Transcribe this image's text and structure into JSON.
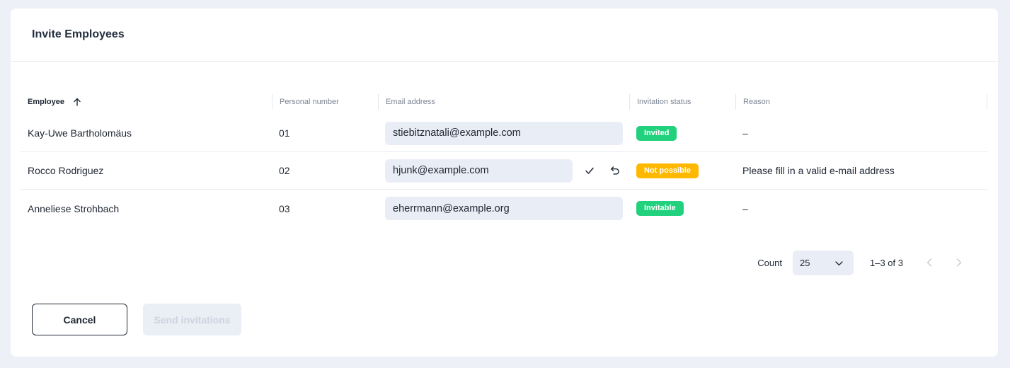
{
  "dialog": {
    "title": "Invite Employees"
  },
  "table": {
    "columns": {
      "employee": "Employee",
      "personal_number": "Personal number",
      "email": "Email address",
      "status": "Invitation status",
      "reason": "Reason"
    },
    "sort": {
      "column": "Employee",
      "direction": "ascending",
      "icon": "arrow-up-icon"
    },
    "rows": [
      {
        "employee": "Kay-Uwe Bartholomäus",
        "personal_number": "01",
        "email": "stiebitznatali@example.com",
        "status": "Invited",
        "reason": "–"
      },
      {
        "employee": "Rocco Rodriguez",
        "personal_number": "02",
        "email": "hjunk@example.com",
        "status": "Not possible",
        "reason": "Please fill in a valid e-mail address"
      },
      {
        "employee": "Anneliese Strohbach",
        "personal_number": "03",
        "email": "eherrmann@example.org",
        "status": "Invitable",
        "reason": "–"
      }
    ]
  },
  "pagination": {
    "count_label": "Count",
    "page_size": "25",
    "range": "1–3 of 3"
  },
  "actions": {
    "cancel": "Cancel",
    "send": "Send invitations"
  },
  "colors": {
    "status_invited": "#22d17d",
    "status_not_possible": "#ffb800",
    "status_invitable": "#22d17d",
    "background": "#edf0f7",
    "input_bg": "#e9edf5"
  }
}
